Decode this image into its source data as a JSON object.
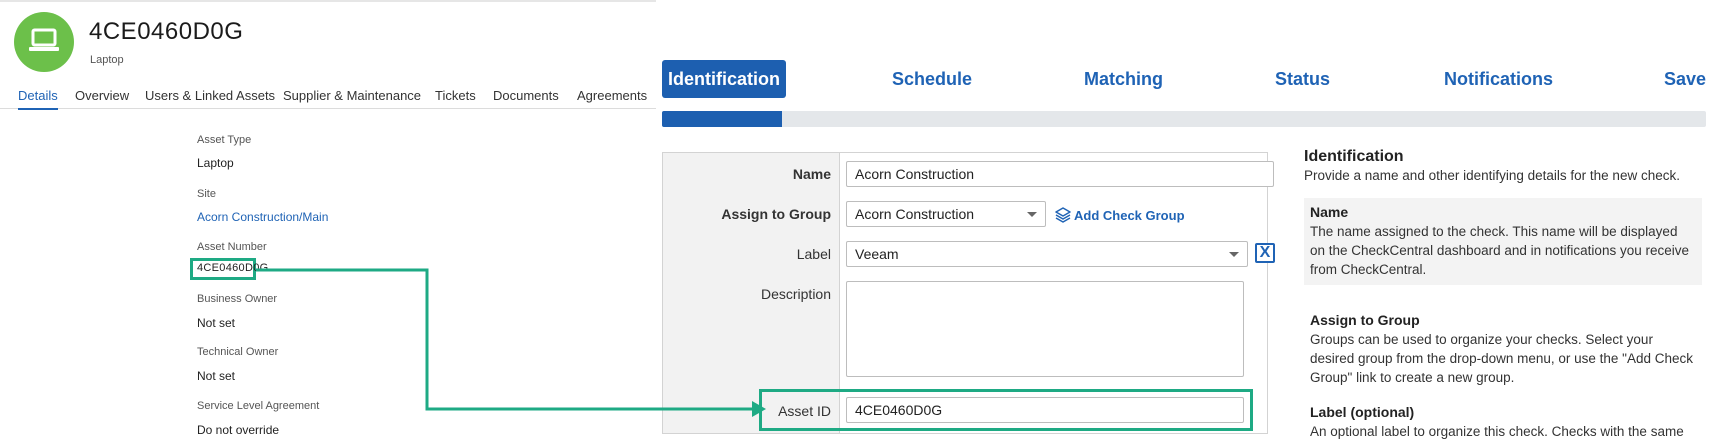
{
  "asset": {
    "title": "4CE0460D0G",
    "subtitle": "Laptop",
    "tabs": [
      "Details",
      "Overview",
      "Users & Linked Assets",
      "Supplier & Maintenance",
      "Tickets",
      "Documents",
      "Agreements"
    ],
    "fields": {
      "asset_type_label": "Asset Type",
      "asset_type_value": "Laptop",
      "site_label": "Site",
      "site_value": "Acorn Construction/Main",
      "asset_number_label": "Asset Number",
      "asset_number_value": "4CE0460D0G",
      "business_owner_label": "Business Owner",
      "business_owner_value": "Not set",
      "technical_owner_label": "Technical Owner",
      "technical_owner_value": "Not set",
      "sla_label": "Service Level Agreement",
      "sla_value": "Do not override"
    }
  },
  "wizard": {
    "steps": [
      "Identification",
      "Schedule",
      "Matching",
      "Status",
      "Notifications",
      "Save"
    ],
    "active_step": "Identification",
    "progress": 0.115
  },
  "form": {
    "name_label": "Name",
    "name_value": "Acorn Construction",
    "group_label": "Assign to Group",
    "group_value": "Acorn Construction",
    "add_group_label": "Add Check Group",
    "label_label": "Label",
    "label_value": "Veeam",
    "clear_symbol": "X",
    "description_label": "Description",
    "asset_id_label": "Asset ID",
    "asset_id_value": "4CE0460D0G"
  },
  "help": {
    "title": "Identification",
    "intro": "Provide a name and other identifying details for the new check.",
    "name_title": "Name",
    "name_text": "The name assigned to the check. This name will be displayed on the CheckCentral dashboard and in notifications you receive from CheckCentral.",
    "group_title": "Assign to Group",
    "group_text": "Groups can be used to organize your checks. Select your desired group from the drop-down menu, or use the \"Add Check Group\" link to create a new group.",
    "label_title": "Label (optional)",
    "label_text": "An optional label to organize this check. Checks with the same"
  },
  "colors": {
    "accent": "#1f63b5",
    "highlight": "#1eaa84",
    "avatar": "#6cc04a"
  },
  "icons": {
    "avatar": "laptop-icon",
    "add_group": "layers-icon",
    "select": "caret-down-icon",
    "clear": "close-icon"
  }
}
